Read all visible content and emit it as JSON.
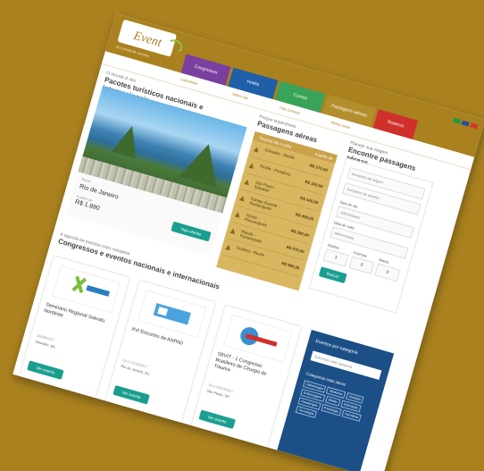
{
  "header": {
    "logo_text": "Event",
    "tagline": "Seu portal de eventos",
    "tabs": [
      {
        "label": "Congressos",
        "color": "#7b3fa0"
      },
      {
        "label": "Hotéis",
        "color": "#1f5fa8"
      },
      {
        "label": "Cursos",
        "color": "#3aa35a"
      },
      {
        "label": "Passagens aéreas",
        "color": "#b38e2c"
      },
      {
        "label": "Roteiros",
        "color": "#d0302c"
      }
    ]
  },
  "nav": {
    "items": [
      "Calendário",
      "Sobre nós",
      "Fale conosco",
      "Minha conta"
    ]
  },
  "destinations": {
    "kicker": "O mundo é seu",
    "title": "Pacotes turísticos nacionais e internacionais",
    "country": "Brasil",
    "city": "Rio de Janeiro",
    "from_label": "A partir de",
    "price": "R$ 1.890",
    "button": "Veja ofertas"
  },
  "flights": {
    "kicker": "Preços imperdíveis",
    "title": "Passagens aéreas",
    "col_route": "Trechos ida e volta",
    "col_price": "A partir de",
    "routes": [
      {
        "name": "Salvador - Recife",
        "price": "R$ 270,00"
      },
      {
        "name": "Recife - Fortaleza",
        "price": "R$ 320,00"
      },
      {
        "name": "São Paulo - Salvador",
        "price": "R$ 440,00"
      },
      {
        "name": "Campo Grande - Florianópolis",
        "price": "R$ 490,00"
      },
      {
        "name": "Vitória - Florianópolis",
        "price": "R$ 380,00"
      },
      {
        "name": "Macaé - Florianópolis",
        "price": "R$ 470,00"
      },
      {
        "name": "Goiânia - Recife",
        "price": "R$ 590,00"
      }
    ]
  },
  "search": {
    "kicker": "Planeje sua viagem",
    "title": "Encontre passagens aéreas",
    "origin_placeholder": "Aeroporto de origem",
    "destination_placeholder": "Aeroporto de destino",
    "depart_label": "Data de ida",
    "depart_placeholder": "dd/mm/aaaa",
    "return_label": "Data de volta",
    "return_placeholder": "dd/mm/aaaa",
    "adults_label": "Adultos",
    "children_label": "Crianças",
    "babies_label": "Bebês",
    "adults": "1",
    "children": "0",
    "babies": "0",
    "button": "Buscar"
  },
  "events": {
    "kicker": "A agenda de eventos mais completa",
    "title": "Congressos e eventos nacionais e internacionais",
    "cards": [
      {
        "name": "Seminário Regional Sobrafo Nordeste",
        "date": "16/09/2017",
        "place": "Salvador, BA",
        "button": "Ver evento"
      },
      {
        "name": "XVI Encontro da ANPAD",
        "date": "18 a 22/10/2017",
        "place": "Rio de Janeiro, RJ",
        "button": "Ver evento"
      },
      {
        "name": "SBVIT - 1 Congresso Brasileiro de Cirurgia de Trauma",
        "date": "26 a 28/10/2017",
        "place": "São Paulo, SP",
        "button": "Ver evento"
      }
    ]
  },
  "categories": {
    "title": "Eventos por categoria",
    "select_placeholder": "Selecione uma categoria",
    "popular_title": "Categorias mais ativas",
    "chips": [
      "Odontologia",
      "Medicina",
      "Nutrição",
      "Enfermagem",
      "Direito",
      "Educação",
      "Fisioterapia",
      "Psicologia",
      "Farmácia",
      "Tecnologia"
    ]
  }
}
